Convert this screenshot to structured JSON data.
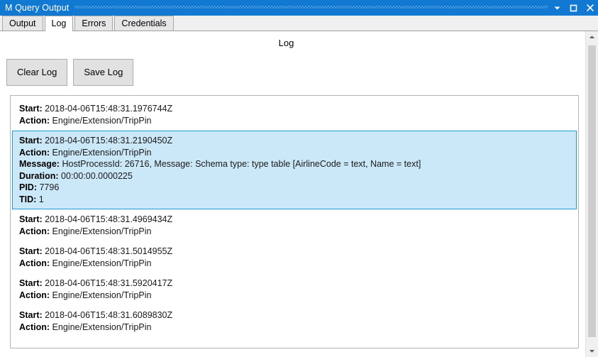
{
  "window": {
    "title": "M Query Output",
    "controls": {
      "minimize_label": "Minimize",
      "maximize_label": "Maximize",
      "close_label": "Close"
    },
    "titlebar_color": "#1279d3"
  },
  "tabs": [
    {
      "label": "Output",
      "active": false
    },
    {
      "label": "Log",
      "active": true
    },
    {
      "label": "Errors",
      "active": false
    },
    {
      "label": "Credentials",
      "active": false
    }
  ],
  "page": {
    "heading": "Log"
  },
  "toolbar": {
    "clear_log_label": "Clear Log",
    "save_log_label": "Save Log"
  },
  "log": {
    "field_labels": {
      "start": "Start:",
      "action": "Action:",
      "message": "Message:",
      "duration": "Duration:",
      "pid": "PID:",
      "tid": "TID:"
    },
    "selected_index": 1,
    "selection_color": "#cbe8f8",
    "selection_border_color": "#1e9bd2",
    "entries": [
      {
        "start": "2018-04-06T15:48:31.1976744Z",
        "action": "Engine/Extension/TripPin"
      },
      {
        "start": "2018-04-06T15:48:31.2190450Z",
        "action": "Engine/Extension/TripPin",
        "message": "HostProcessId: 26716, Message: Schema type: type table [AirlineCode = text, Name = text]",
        "duration": "00:00:00.0000225",
        "pid": "7796",
        "tid": "1"
      },
      {
        "start": "2018-04-06T15:48:31.4969434Z",
        "action": "Engine/Extension/TripPin"
      },
      {
        "start": "2018-04-06T15:48:31.5014955Z",
        "action": "Engine/Extension/TripPin"
      },
      {
        "start": "2018-04-06T15:48:31.5920417Z",
        "action": "Engine/Extension/TripPin"
      },
      {
        "start": "2018-04-06T15:48:31.6089830Z",
        "action": "Engine/Extension/TripPin"
      }
    ]
  },
  "scrollbar": {
    "up_arrow": "scroll-up-icon",
    "down_arrow": "scroll-down-icon"
  }
}
